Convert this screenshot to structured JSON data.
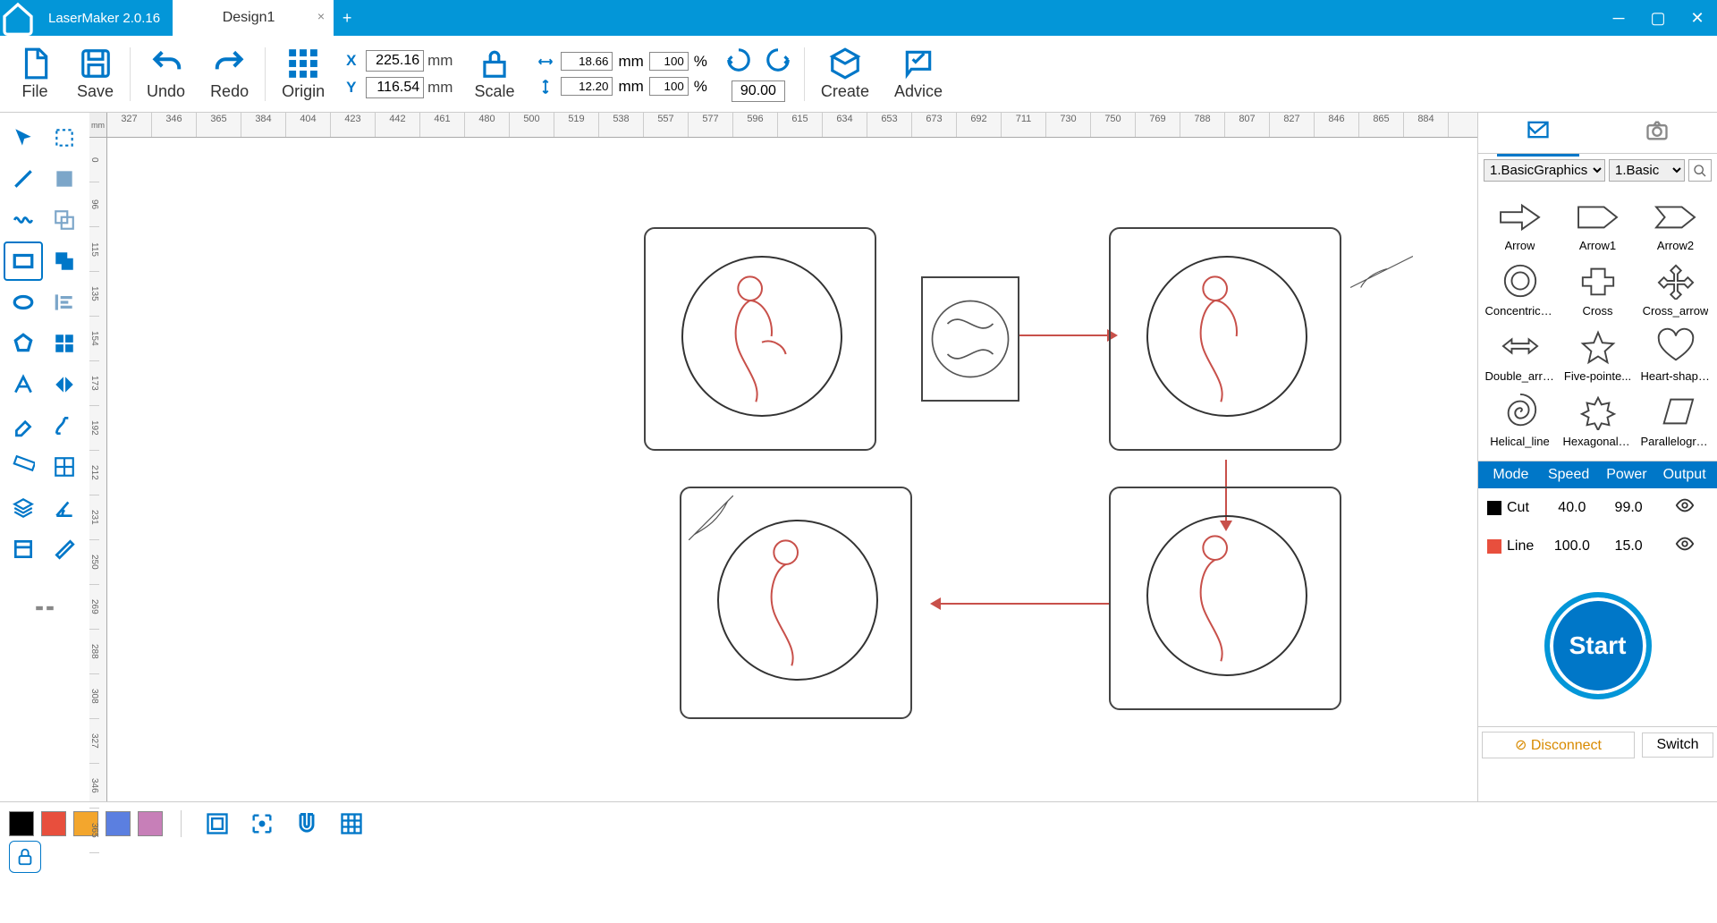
{
  "app": {
    "name": "LaserMaker 2.0.16"
  },
  "tabs": [
    {
      "title": "Design1"
    }
  ],
  "toolbar": {
    "file": "File",
    "save": "Save",
    "undo": "Undo",
    "redo": "Redo",
    "origin": "Origin",
    "x_label": "X",
    "x_value": "225.16",
    "y_label": "Y",
    "y_value": "116.54",
    "mm": "mm",
    "percent": "%",
    "scale": "Scale",
    "w_value": "18.66",
    "w_pct": "100",
    "h_value": "12.20",
    "h_pct": "100",
    "angle": "90.00",
    "create": "Create",
    "advice": "Advice"
  },
  "ruler_corner": "mm",
  "ruler_h": [
    "327",
    "346",
    "365",
    "384",
    "404",
    "423",
    "442",
    "461",
    "480",
    "500",
    "519",
    "538",
    "557",
    "577",
    "596",
    "615",
    "634",
    "653",
    "673",
    "692",
    "711",
    "730",
    "750",
    "769",
    "788",
    "807",
    "827",
    "846",
    "865",
    "884"
  ],
  "ruler_v": [
    "0",
    "96",
    "115",
    "135",
    "154",
    "173",
    "192",
    "212",
    "231",
    "250",
    "269",
    "288",
    "308",
    "327",
    "346",
    "365"
  ],
  "right": {
    "dropdown1": "1.BasicGraphics",
    "dropdown2": "1.Basic",
    "shapes": [
      {
        "name": "Arrow"
      },
      {
        "name": "Arrow1"
      },
      {
        "name": "Arrow2"
      },
      {
        "name": "Concentric_..."
      },
      {
        "name": "Cross"
      },
      {
        "name": "Cross_arrow"
      },
      {
        "name": "Double_arrow"
      },
      {
        "name": "Five-pointe..."
      },
      {
        "name": "Heart-shaped"
      },
      {
        "name": "Helical_line"
      },
      {
        "name": "Hexagonal_..."
      },
      {
        "name": "Parallelogram"
      }
    ]
  },
  "layers": {
    "head": {
      "mode": "Mode",
      "speed": "Speed",
      "power": "Power",
      "output": "Output"
    },
    "rows": [
      {
        "color": "#000000",
        "mode": "Cut",
        "speed": "40.0",
        "power": "99.0"
      },
      {
        "color": "#e84f3d",
        "mode": "Line",
        "speed": "100.0",
        "power": "15.0"
      }
    ]
  },
  "start": "Start",
  "status": {
    "disconnect": "Disconnect",
    "switch": "Switch"
  },
  "palette": [
    "#000000",
    "#e84f3d",
    "#f3a62d",
    "#5b7fe0",
    "#c77fb8"
  ]
}
